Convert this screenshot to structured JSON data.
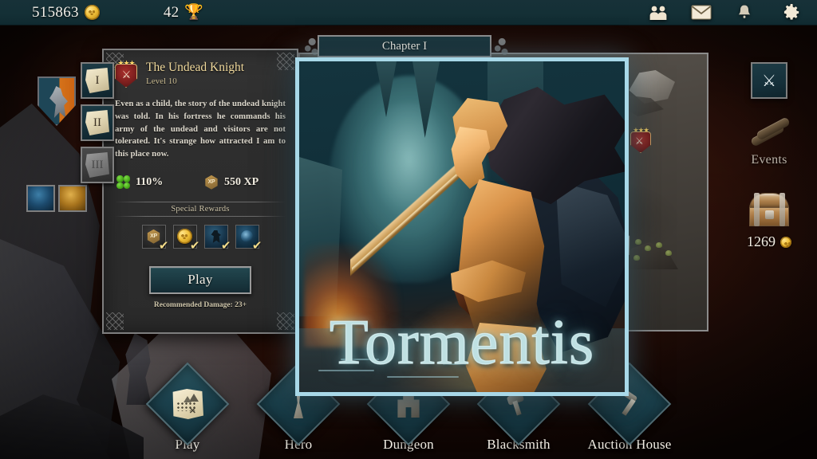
{
  "topbar": {
    "gold": "515863",
    "gold_icon": "coin-icon",
    "trophies": "42",
    "trophy_icon": "trophy-icon",
    "icons": [
      {
        "name": "friends-icon",
        "label": "Friends"
      },
      {
        "name": "mail-icon",
        "label": "Mail"
      },
      {
        "name": "notifications-icon",
        "label": "Notifications"
      },
      {
        "name": "settings-gear-icon",
        "label": "Settings"
      }
    ]
  },
  "chapter_nav": {
    "items": [
      {
        "label": "I",
        "locked": false
      },
      {
        "label": "II",
        "locked": false
      },
      {
        "label": "III",
        "locked": true
      }
    ]
  },
  "chapter_header": {
    "title": "Chapter I"
  },
  "quest": {
    "title": "The Undead Knight",
    "level": "Level 10",
    "stars": "★★★",
    "description": "Even as a child, the story of the undead knight was told. In his fortress he commands his army of the undead and visitors are not tolerated. It's strange how attracted I am to this place now.",
    "luck_value": "110%",
    "luck_icon": "clover-icon",
    "xp_value": "550 XP",
    "xp_icon": "xp-badge-icon",
    "special_rewards_label": "Special Rewards",
    "rewards": [
      {
        "name": "xp-reward",
        "icon": "xp-hex-icon",
        "claimed": "✔"
      },
      {
        "name": "gold-reward",
        "icon": "gold-coin-icon",
        "claimed": "✔"
      },
      {
        "name": "monster-reward",
        "icon": "undead-icon",
        "claimed": "✔"
      },
      {
        "name": "item-reward",
        "icon": "rune-icon",
        "claimed": "✔"
      }
    ],
    "play_label": "Play",
    "recommended": "Recommended Damage: 23+"
  },
  "splash": {
    "title": "Tormentis"
  },
  "right_rail": {
    "battle_icon": "crossed-swords-icon",
    "events_label": "Events",
    "events_icon": "scrolls-icon",
    "chest_icon": "treasure-chest-icon",
    "chest_count": "1269",
    "chest_coin_icon": "coin-icon"
  },
  "bottom_nav": {
    "items": [
      {
        "label": "Play",
        "icon": "map-icon"
      },
      {
        "label": "Hero",
        "icon": "hero-icon"
      },
      {
        "label": "Dungeon",
        "icon": "dungeon-gate-icon"
      },
      {
        "label": "Blacksmith",
        "icon": "hammer-icon"
      },
      {
        "label": "Auction House",
        "icon": "gavel-icon"
      }
    ]
  },
  "colors": {
    "topbar": "#173138",
    "background": "#2c1009",
    "panel": "#2e2e2e",
    "accent_teal": "#1a3840",
    "splash_border": "#a8d8e8",
    "gold_text": "#f0d99c"
  }
}
